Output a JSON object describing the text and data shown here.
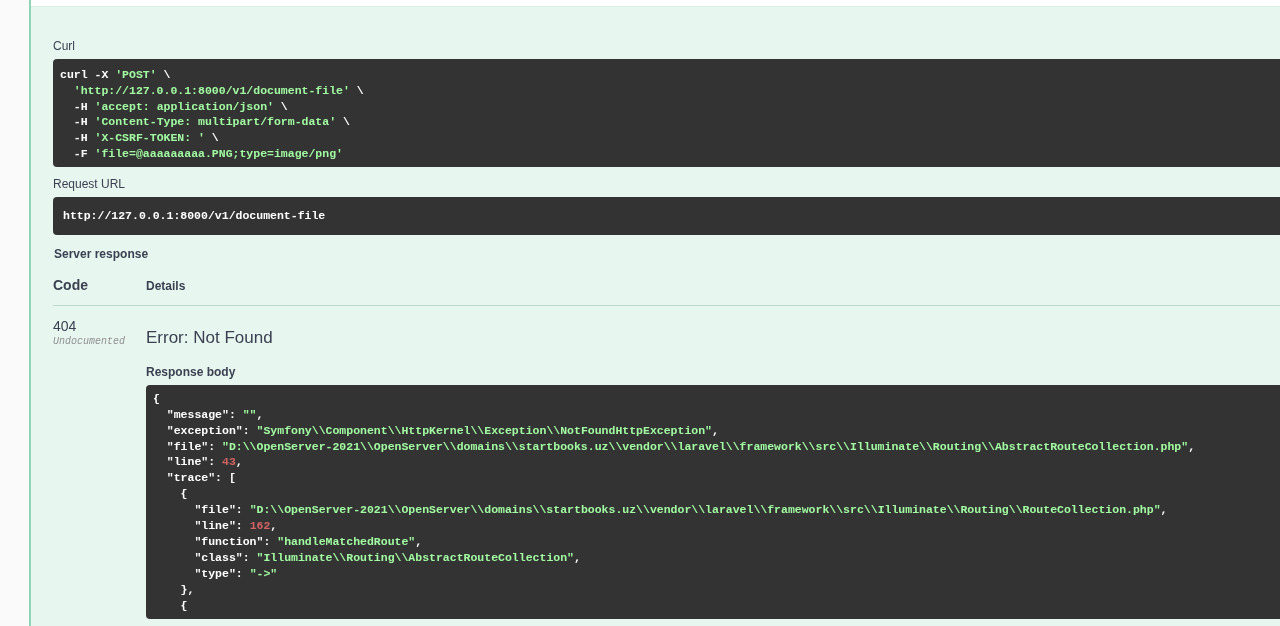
{
  "curl": {
    "label": "Curl",
    "lines": [
      [
        {
          "text": "curl -X ",
          "kind": "plain"
        },
        {
          "text": "'POST'",
          "kind": "string"
        },
        {
          "text": " \\",
          "kind": "plain"
        }
      ],
      [
        {
          "text": "  'http://127.0.0.1:8000/v1/document-file'",
          "kind": "string"
        },
        {
          "text": " \\",
          "kind": "plain"
        }
      ],
      [
        {
          "text": "  -H ",
          "kind": "plain"
        },
        {
          "text": "'accept: application/json'",
          "kind": "string"
        },
        {
          "text": " \\",
          "kind": "plain"
        }
      ],
      [
        {
          "text": "  -H ",
          "kind": "plain"
        },
        {
          "text": "'Content-Type: multipart/form-data'",
          "kind": "string"
        },
        {
          "text": " \\",
          "kind": "plain"
        }
      ],
      [
        {
          "text": "  -H ",
          "kind": "plain"
        },
        {
          "text": "'X-CSRF-TOKEN: '",
          "kind": "string"
        },
        {
          "text": " \\",
          "kind": "plain"
        }
      ],
      [
        {
          "text": "  -F ",
          "kind": "plain"
        },
        {
          "text": "'file=@aaaaaaaaa.PNG;type=image/png'",
          "kind": "string"
        }
      ]
    ]
  },
  "request_url": {
    "label": "Request URL",
    "value": "http://127.0.0.1:8000/v1/document-file"
  },
  "server_response": {
    "label": "Server response",
    "columns": [
      "Code",
      "Details"
    ],
    "code": "404",
    "code_note": "Undocumented",
    "error": "Error: Not Found",
    "body_label": "Response body",
    "body_lines": [
      [
        {
          "text": "{",
          "kind": "plain"
        }
      ],
      [
        {
          "text": "  \"message\": ",
          "kind": "plain"
        },
        {
          "text": "\"\"",
          "kind": "string"
        },
        {
          "text": ",",
          "kind": "plain"
        }
      ],
      [
        {
          "text": "  \"exception\": ",
          "kind": "plain"
        },
        {
          "text": "\"Symfony\\\\Component\\\\HttpKernel\\\\Exception\\\\NotFoundHttpException\"",
          "kind": "string"
        },
        {
          "text": ",",
          "kind": "plain"
        }
      ],
      [
        {
          "text": "  \"file\": ",
          "kind": "plain"
        },
        {
          "text": "\"D:\\\\OpenServer-2021\\\\OpenServer\\\\domains\\\\startbooks.uz\\\\vendor\\\\laravel\\\\framework\\\\src\\\\Illuminate\\\\Routing\\\\AbstractRouteCollection.php\"",
          "kind": "string"
        },
        {
          "text": ",",
          "kind": "plain"
        }
      ],
      [
        {
          "text": "  \"line\": ",
          "kind": "plain"
        },
        {
          "text": "43",
          "kind": "number"
        },
        {
          "text": ",",
          "kind": "plain"
        }
      ],
      [
        {
          "text": "  \"trace\": [",
          "kind": "plain"
        }
      ],
      [
        {
          "text": "    {",
          "kind": "plain"
        }
      ],
      [
        {
          "text": "      \"file\": ",
          "kind": "plain"
        },
        {
          "text": "\"D:\\\\OpenServer-2021\\\\OpenServer\\\\domains\\\\startbooks.uz\\\\vendor\\\\laravel\\\\framework\\\\src\\\\Illuminate\\\\Routing\\\\RouteCollection.php\"",
          "kind": "string"
        },
        {
          "text": ",",
          "kind": "plain"
        }
      ],
      [
        {
          "text": "      \"line\": ",
          "kind": "plain"
        },
        {
          "text": "162",
          "kind": "number"
        },
        {
          "text": ",",
          "kind": "plain"
        }
      ],
      [
        {
          "text": "      \"function\": ",
          "kind": "plain"
        },
        {
          "text": "\"handleMatchedRoute\"",
          "kind": "string"
        },
        {
          "text": ",",
          "kind": "plain"
        }
      ],
      [
        {
          "text": "      \"class\": ",
          "kind": "plain"
        },
        {
          "text": "\"Illuminate\\\\Routing\\\\AbstractRouteCollection\"",
          "kind": "string"
        },
        {
          "text": ",",
          "kind": "plain"
        }
      ],
      [
        {
          "text": "      \"type\": ",
          "kind": "plain"
        },
        {
          "text": "\"->\"",
          "kind": "string"
        }
      ],
      [
        {
          "text": "    },",
          "kind": "plain"
        }
      ],
      [
        {
          "text": "    {",
          "kind": "plain"
        }
      ]
    ]
  }
}
